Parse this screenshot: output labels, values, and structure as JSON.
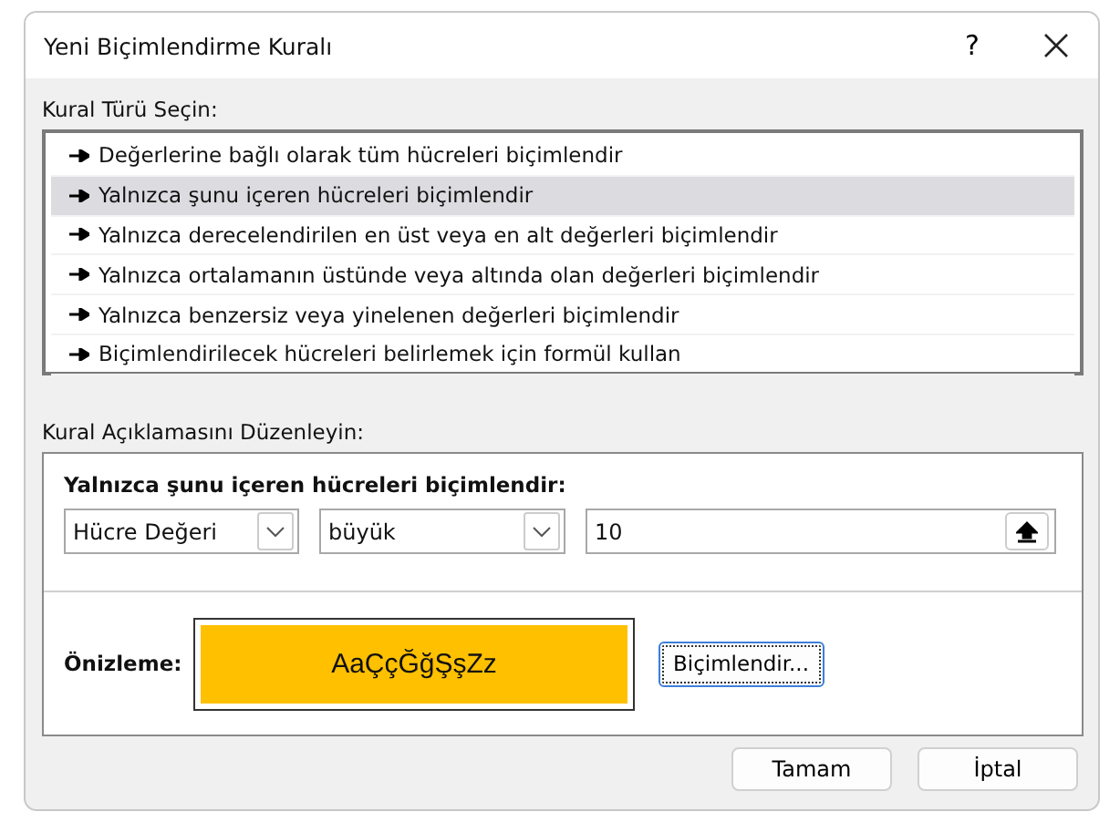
{
  "window": {
    "title": "Yeni Biçimlendirme Kuralı",
    "help": "?"
  },
  "rule_type": {
    "label": "Kural Türü Seçin:",
    "items": [
      {
        "label": "Değerlerine bağlı olarak tüm hücreleri biçimlendir",
        "selected": false
      },
      {
        "label": "Yalnızca şunu içeren hücreleri biçimlendir",
        "selected": true
      },
      {
        "label": "Yalnızca derecelendirilen en üst veya en alt değerleri biçimlendir",
        "selected": false
      },
      {
        "label": "Yalnızca ortalamanın üstünde veya altında olan değerleri biçimlendir",
        "selected": false
      },
      {
        "label": "Yalnızca benzersiz veya yinelenen değerleri biçimlendir",
        "selected": false
      },
      {
        "label": "Biçimlendirilecek hücreleri belirlemek için formül kullan",
        "selected": false
      }
    ]
  },
  "description": {
    "label": "Kural Açıklamasını Düzenleyin:",
    "heading": "Yalnızca şunu içeren hücreleri biçimlendir:",
    "condition": {
      "field": "Hücre Değeri",
      "operator": "büyük",
      "value": "10"
    },
    "preview": {
      "label": "Önizleme:",
      "sample": "AaÇçĞğŞşZz",
      "color": "#ffc000"
    },
    "format_button": "Biçimlendir..."
  },
  "buttons": [
    "Tamam",
    "İptal"
  ]
}
